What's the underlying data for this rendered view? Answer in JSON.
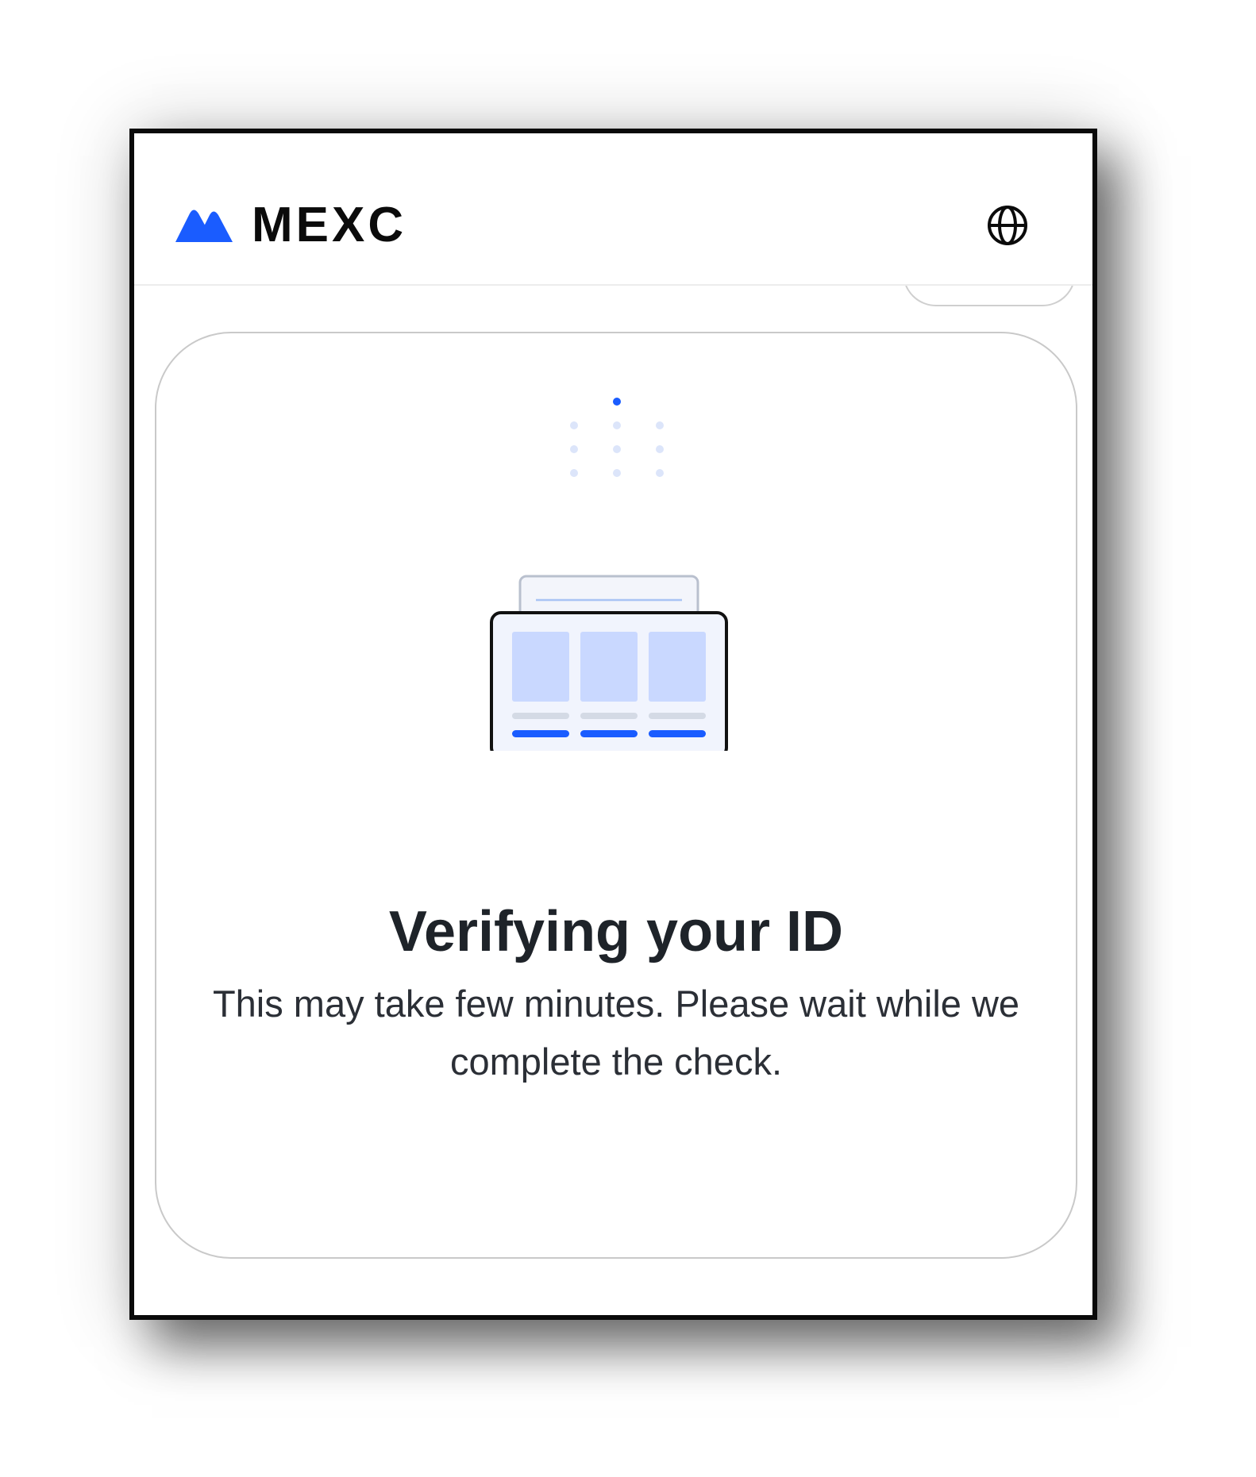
{
  "header": {
    "brand_name": "MEXC",
    "brand_color": "#1A5CFF",
    "logo_icon": "mexc-mountain-logo-icon",
    "language_icon": "globe-icon"
  },
  "verification": {
    "title": "Verifying your ID",
    "message": "This may take few minutes. Please wait while we complete the check.",
    "loader_icon": "dots-loading-icon",
    "illustration": "id-document-illustration",
    "accent_color": "#1A5CFF",
    "light_accent_color": "#C9D8FF",
    "text_color": "#1E2329"
  }
}
